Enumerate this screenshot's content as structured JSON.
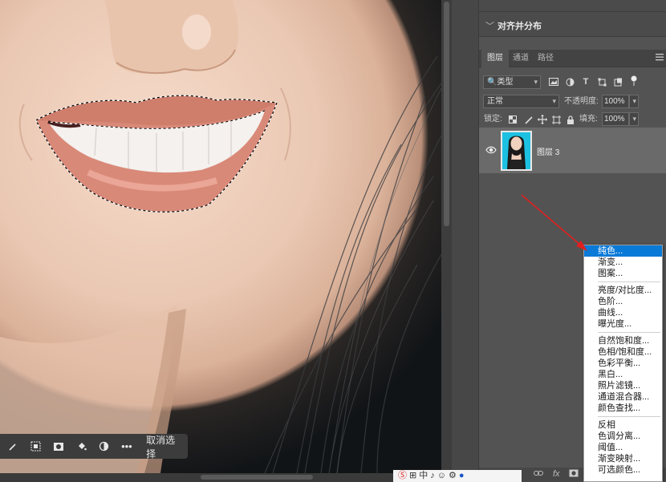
{
  "align_panel": {
    "title": "对齐并分布"
  },
  "layers_panel": {
    "tabs": [
      "图层",
      "通道",
      "路径"
    ],
    "filter_kind": "类型",
    "blend_mode": "正常",
    "opacity_label": "不透明度:",
    "opacity_value": "100%",
    "lock_label": "锁定:",
    "fill_label": "填充:",
    "fill_value": "100%",
    "layer": {
      "name": "图层 3"
    },
    "bottom_icons": [
      "link-icon",
      "fx-icon",
      "mask-icon"
    ],
    "bottom_fx": "fx"
  },
  "canvas_toolbar": {
    "deselect_label": "取消选择"
  },
  "ime": {
    "lang": "中"
  },
  "adjustment_menu": {
    "group1": [
      "纯色...",
      "渐变...",
      "图案..."
    ],
    "group2": [
      "亮度/对比度...",
      "色阶...",
      "曲线...",
      "曝光度..."
    ],
    "group3": [
      "自然饱和度...",
      "色相/饱和度...",
      "色彩平衡...",
      "黑白...",
      "照片滤镜...",
      "通道混合器...",
      "颜色查找..."
    ],
    "group4": [
      "反相",
      "色调分离...",
      "阈值...",
      "渐变映射...",
      "可选颜色..."
    ],
    "highlighted": "纯色..."
  },
  "colors": {
    "highlight": "#0a7ad8",
    "arrow": "#e02020",
    "layer_thumb_bg": "#1cc1e2"
  }
}
